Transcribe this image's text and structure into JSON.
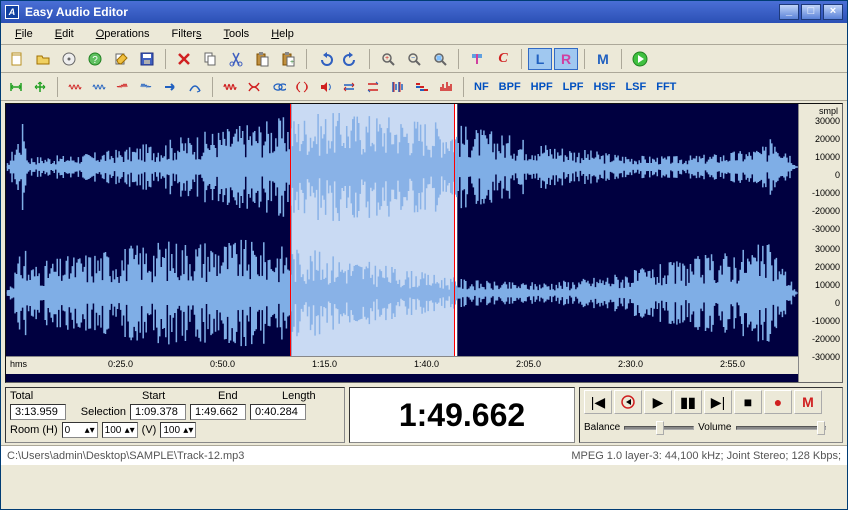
{
  "title": "Easy Audio Editor",
  "menus": [
    "File",
    "Edit",
    "Operations",
    "Filters",
    "Tools",
    "Help"
  ],
  "toolbar1": {
    "new": "new",
    "open": "open",
    "cd": "cd",
    "help": "help",
    "edit": "edit",
    "save": "save",
    "del": "del",
    "copy": "copy",
    "cut": "cut",
    "paste": "paste",
    "pastefile": "pastefile",
    "undo": "undo",
    "redo": "redo",
    "zoomin": "zoomin",
    "zoomout": "zoomout",
    "zoomsel": "zoomsel",
    "marker": "marker",
    "c": "C",
    "l": "L",
    "r": "R",
    "m": "M",
    "play": "play"
  },
  "toolbar2": {
    "sel_all": "sel-all",
    "sel_add": "sel-add",
    "w1": "w1",
    "w2": "w2",
    "w3": "w3",
    "w4": "w4",
    "arr1": "arr1",
    "arr2": "arr2",
    "fx1": "fx1",
    "fx2": "fx2",
    "fx3": "fx3",
    "fx4": "fx4",
    "fx5": "fx5",
    "fx6": "fx6",
    "fx7": "fx7",
    "fx8": "fx8",
    "fx9": "fx9",
    "fx10": "fx10",
    "fx11": "fx11",
    "nf": "NF",
    "bpf": "BPF",
    "hpf": "HPF",
    "lpf": "LPF",
    "hsf": "HSF",
    "lsf": "LSF",
    "fft": "FFT"
  },
  "ruler": {
    "smpl": "smpl",
    "ticks": [
      30000,
      20000,
      10000,
      0,
      -10000,
      -20000,
      -30000
    ]
  },
  "timeline": {
    "hms": "hms",
    "ticks": [
      "0:25.0",
      "0:50.0",
      "1:15.0",
      "1:40.0",
      "2:05.0",
      "2:30.0",
      "2:55.0"
    ]
  },
  "info": {
    "total_lbl": "Total",
    "total": "3:13.959",
    "start_lbl": "Start",
    "end_lbl": "End",
    "length_lbl": "Length",
    "sel_lbl": "Selection",
    "start": "1:09.378",
    "end": "1:49.662",
    "length": "0:40.284",
    "room_lbl": "Room (H)",
    "room_h": "0",
    "room_100a": "100",
    "room_v": "(V)",
    "room_100b": "100"
  },
  "big_time": "1:49.662",
  "transport": {
    "begin": "begin",
    "stop2": "stop2",
    "play": "play",
    "pause": "pause",
    "fwd": "fwd",
    "end": "end",
    "rec": "rec",
    "m": "M"
  },
  "balance_lbl": "Balance",
  "volume_lbl": "Volume",
  "status": {
    "path": "C:\\Users\\admin\\Desktop\\SAMPLE\\Track-12.mp3",
    "fmt": "MPEG 1.0 layer-3: 44,100 kHz; Joint Stereo; 128 Kbps;"
  },
  "colors": {
    "wave_fill": "#7faee6",
    "wave_stroke": "#04083a",
    "sel_bg": "#ffffff",
    "sel_wave": "#7faee6"
  }
}
